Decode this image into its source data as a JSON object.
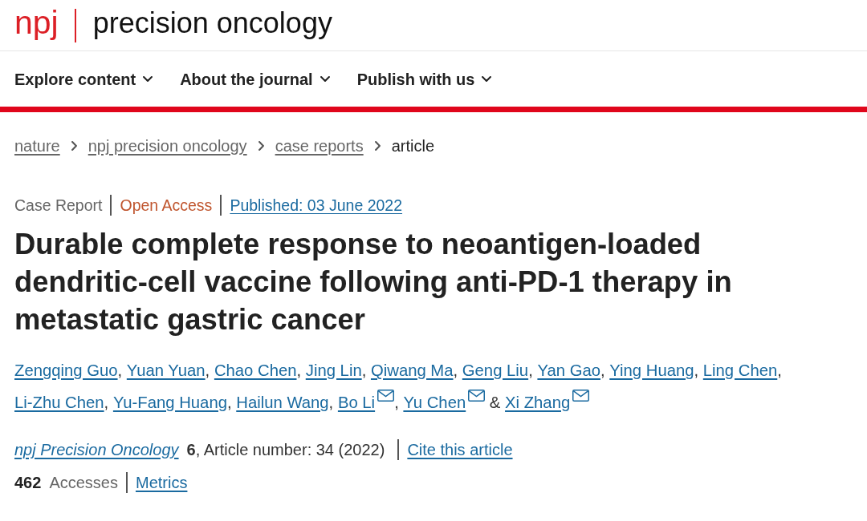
{
  "header": {
    "logo_mark": "npj",
    "journal_name": "precision oncology"
  },
  "nav": [
    {
      "label": "Explore content"
    },
    {
      "label": "About the journal"
    },
    {
      "label": "Publish with us"
    }
  ],
  "breadcrumbs": [
    {
      "label": "nature",
      "kind": "link"
    },
    {
      "label": "npj precision oncology",
      "kind": "link"
    },
    {
      "label": "case reports",
      "kind": "link"
    },
    {
      "label": "article",
      "kind": "current"
    }
  ],
  "article_meta": {
    "article_type": "Case Report",
    "access": "Open Access",
    "published": "Published: 03 June 2022"
  },
  "title": "Durable complete response to neoantigen-loaded dendritic-cell vaccine following anti-PD-1 therapy in metastatic gastric cancer",
  "authors": {
    "separator": ",",
    "last_separator": "&",
    "list": [
      {
        "name": "Zengqing Guo",
        "corresponding": false
      },
      {
        "name": "Yuan Yuan",
        "corresponding": false
      },
      {
        "name": "Chao Chen",
        "corresponding": false
      },
      {
        "name": "Jing Lin",
        "corresponding": false
      },
      {
        "name": "Qiwang Ma",
        "corresponding": false
      },
      {
        "name": "Geng Liu",
        "corresponding": false
      },
      {
        "name": "Yan Gao",
        "corresponding": false
      },
      {
        "name": "Ying Huang",
        "corresponding": false
      },
      {
        "name": "Ling Chen",
        "corresponding": false
      },
      {
        "name": "Li-Zhu Chen",
        "corresponding": false
      },
      {
        "name": "Yu-Fang Huang",
        "corresponding": false
      },
      {
        "name": "Hailun Wang",
        "corresponding": false
      },
      {
        "name": "Bo Li",
        "corresponding": true
      },
      {
        "name": "Yu Chen",
        "corresponding": true
      },
      {
        "name": "Xi Zhang",
        "corresponding": true
      }
    ]
  },
  "citation": {
    "journal": "npj Precision Oncology",
    "details": "**6**, Article number: 34 (2022)",
    "cite_link": "Cite this article"
  },
  "metrics": {
    "accesses_count": "462",
    "accesses_label": "Accesses",
    "metrics_link": "Metrics"
  }
}
